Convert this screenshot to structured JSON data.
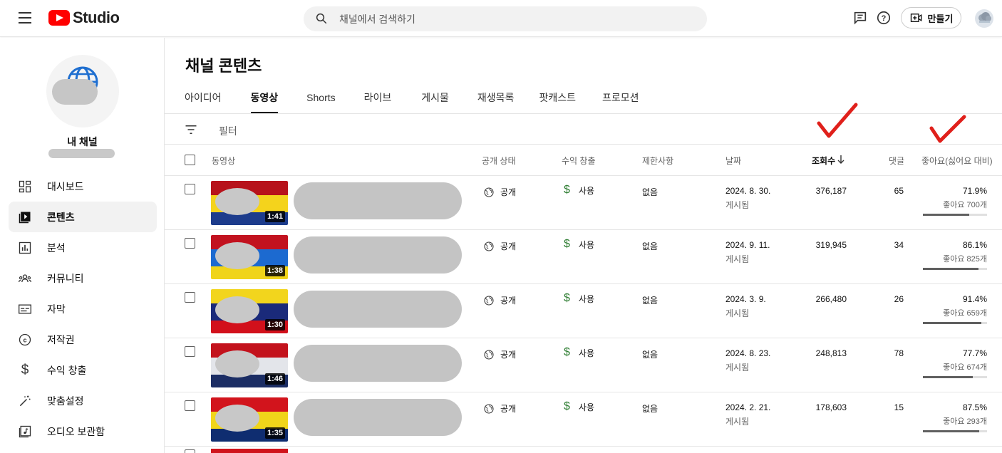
{
  "header": {
    "logo_text": "Studio",
    "search_placeholder": "채널에서 검색하기",
    "create_label": "만들기"
  },
  "sidebar": {
    "channel_name": "내 채널",
    "items": [
      {
        "label": "대시보드",
        "icon": "dashboard-icon"
      },
      {
        "label": "콘텐츠",
        "icon": "content-icon",
        "active": true
      },
      {
        "label": "분석",
        "icon": "analytics-icon"
      },
      {
        "label": "커뮤니티",
        "icon": "community-icon"
      },
      {
        "label": "자막",
        "icon": "subtitles-icon"
      },
      {
        "label": "저작권",
        "icon": "copyright-icon"
      },
      {
        "label": "수익 창출",
        "icon": "dollar-icon"
      },
      {
        "label": "맞춤설정",
        "icon": "magic-wand-icon"
      },
      {
        "label": "오디오 보관함",
        "icon": "audio-library-icon"
      }
    ]
  },
  "main": {
    "title": "채널 콘텐츠",
    "tabs": [
      {
        "label": "아이디어"
      },
      {
        "label": "동영상",
        "active": true
      },
      {
        "label": "Shorts"
      },
      {
        "label": "라이브"
      },
      {
        "label": "게시물"
      },
      {
        "label": "재생목록"
      },
      {
        "label": "팟캐스트"
      },
      {
        "label": "프로모션"
      }
    ],
    "filter_label": "필터"
  },
  "table": {
    "columns": {
      "video": "동영상",
      "visibility": "공개 상태",
      "monetization": "수익 창출",
      "restrictions": "제한사항",
      "date": "날짜",
      "views": "조회수",
      "comments": "댓글",
      "likes": "좋아요(싫어요 대비)"
    },
    "rows": [
      {
        "duration": "1:41",
        "visibility": "공개",
        "monetization": "사용",
        "restrictions": "없음",
        "date": "2024. 8. 30.",
        "date_status": "게시됨",
        "views": "376,187",
        "comments": "65",
        "like_pct": "71.9%",
        "like_count": "좋아요 700개",
        "like_ratio": 0.719
      },
      {
        "duration": "1:38",
        "visibility": "공개",
        "monetization": "사용",
        "restrictions": "없음",
        "date": "2024. 9. 11.",
        "date_status": "게시됨",
        "views": "319,945",
        "comments": "34",
        "like_pct": "86.1%",
        "like_count": "좋아요 825개",
        "like_ratio": 0.861
      },
      {
        "duration": "1:30",
        "visibility": "공개",
        "monetization": "사용",
        "restrictions": "없음",
        "date": "2024. 3. 9.",
        "date_status": "게시됨",
        "views": "266,480",
        "comments": "26",
        "like_pct": "91.4%",
        "like_count": "좋아요 659개",
        "like_ratio": 0.914
      },
      {
        "duration": "1:46",
        "visibility": "공개",
        "monetization": "사용",
        "restrictions": "없음",
        "date": "2024. 8. 23.",
        "date_status": "게시됨",
        "views": "248,813",
        "comments": "78",
        "like_pct": "77.7%",
        "like_count": "좋아요 674개",
        "like_ratio": 0.777
      },
      {
        "duration": "1:35",
        "visibility": "공개",
        "monetization": "사용",
        "restrictions": "없음",
        "date": "2024. 2. 21.",
        "date_status": "게시됨",
        "views": "178,603",
        "comments": "15",
        "like_pct": "87.5%",
        "like_count": "좋아요 293개",
        "like_ratio": 0.875
      }
    ]
  },
  "colors": {
    "accent_red": "#ff0000",
    "annotation_check": "#e0201b",
    "monetization_green": "#2e7d32"
  }
}
